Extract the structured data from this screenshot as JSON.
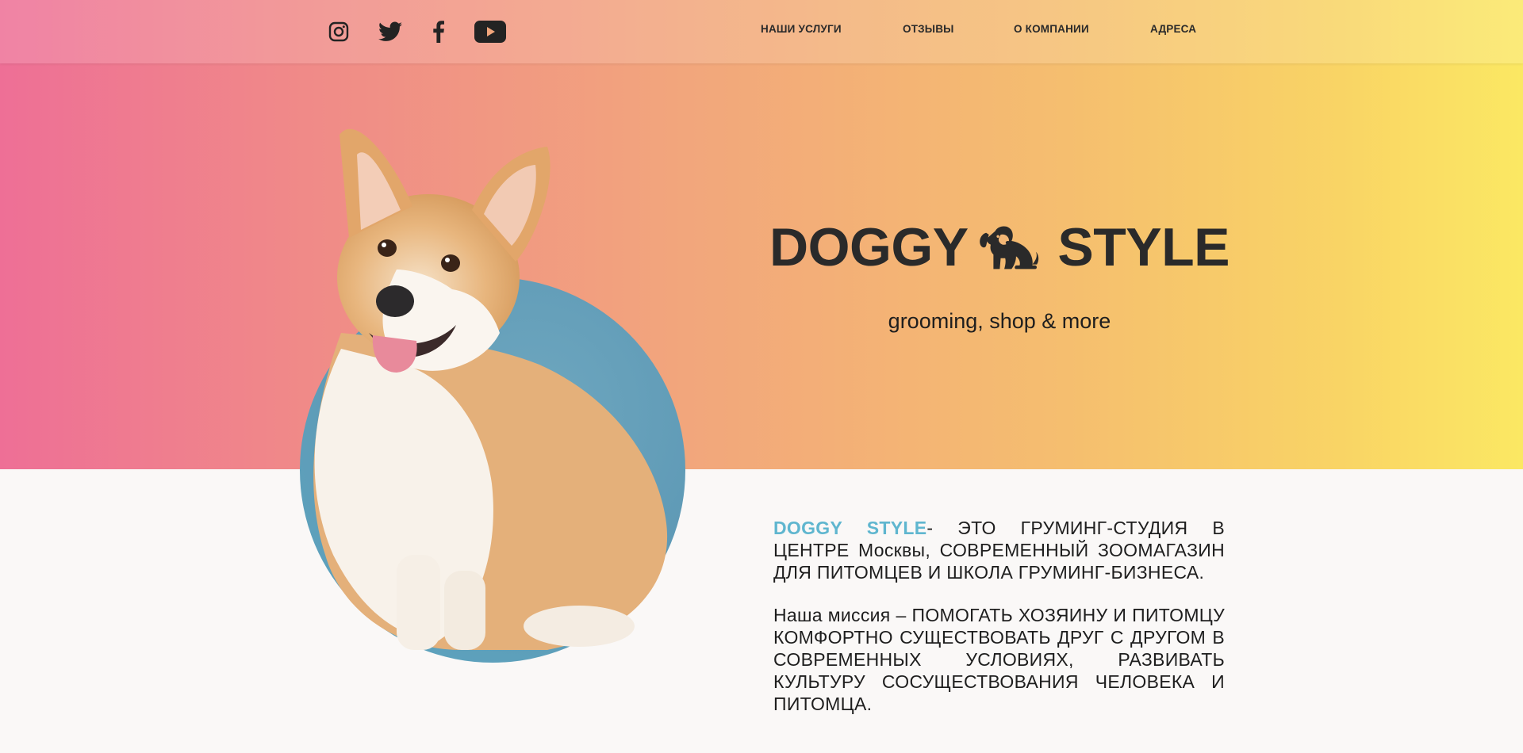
{
  "header": {
    "social": [
      {
        "name": "instagram-icon"
      },
      {
        "name": "twitter-icon"
      },
      {
        "name": "facebook-icon"
      },
      {
        "name": "youtube-icon"
      }
    ],
    "nav": [
      {
        "label": "НАШИ УСЛУГИ"
      },
      {
        "label": "ОТЗЫВЫ"
      },
      {
        "label": "О КОМПАНИИ"
      },
      {
        "label": "АДРЕСА"
      }
    ]
  },
  "hero": {
    "logo_left": "DOGGY",
    "logo_right": "STYLE",
    "tagline": "grooming, shop & more"
  },
  "about": {
    "brand": "DOGGY STYLE",
    "intro_rest": "-  ЭТО ГРУМИНГ-СТУДИЯ В ЦЕНТРЕ Москвы, СОВРЕМЕННЫЙ ЗООМАГАЗИН ДЛЯ ПИТОМЦЕВ И ШКОЛА ГРУМИНГ-БИЗНЕСА.",
    "mission": "Наша миссия – ПОМОГАТЬ ХОЗЯИНУ И ПИТОМЦУ КОМФОРТНО СУЩЕСТВОВАТЬ ДРУГ С ДРУГОМ В СОВРЕМЕННЫХ УСЛОВИЯХ, РАЗВИВАТЬ КУЛЬТУРУ СОСУЩЕСТВОВАНИЯ ЧЕЛОВЕКА И ПИТОМЦА."
  },
  "colors": {
    "gradient_start": "#ee6f96",
    "gradient_end": "#fbe863",
    "accent": "#5fb6cf",
    "circle": "#5f9ab6",
    "text": "#232323"
  }
}
